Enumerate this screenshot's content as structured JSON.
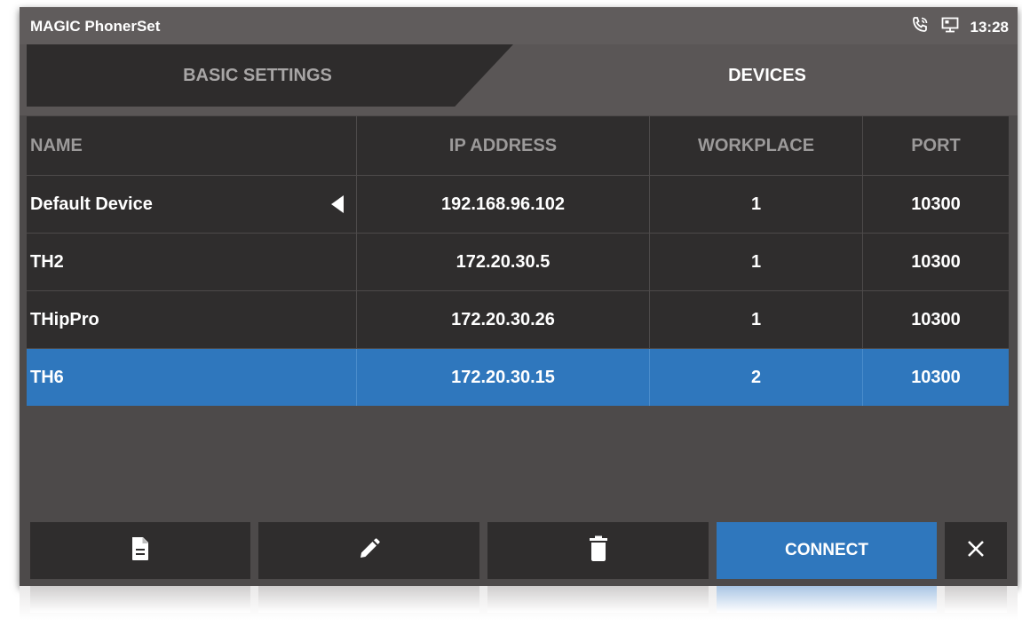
{
  "statusbar": {
    "app_title": "MAGIC PhonerSet",
    "time": "13:28",
    "icons": [
      "phone-ringing-icon",
      "monitor-icon"
    ]
  },
  "tabs": [
    {
      "label": "BASIC SETTINGS",
      "active": false
    },
    {
      "label": "DEVICES",
      "active": true
    }
  ],
  "table": {
    "columns": [
      "NAME",
      "IP ADDRESS",
      "WORKPLACE",
      "PORT"
    ],
    "rows": [
      {
        "name": "Default Device",
        "ip": "192.168.96.102",
        "workplace": "1",
        "port": "10300",
        "marker": "default-marker-icon"
      },
      {
        "name": "TH2",
        "ip": "172.20.30.5",
        "workplace": "1",
        "port": "10300"
      },
      {
        "name": "THipPro",
        "ip": "172.20.30.26",
        "workplace": "1",
        "port": "10300"
      },
      {
        "name": "TH6",
        "ip": "172.20.30.15",
        "workplace": "2",
        "port": "10300",
        "selected": true
      }
    ]
  },
  "toolbar": {
    "new_icon": "document-icon",
    "edit_icon": "pencil-icon",
    "delete_icon": "trash-icon",
    "connect_label": "CONNECT",
    "close_icon": "close-icon"
  },
  "colors": {
    "accent": "#2f77bd",
    "background": "#4d4a4a",
    "cell": "#2f2d2d",
    "statusbar": "#605c5c"
  }
}
